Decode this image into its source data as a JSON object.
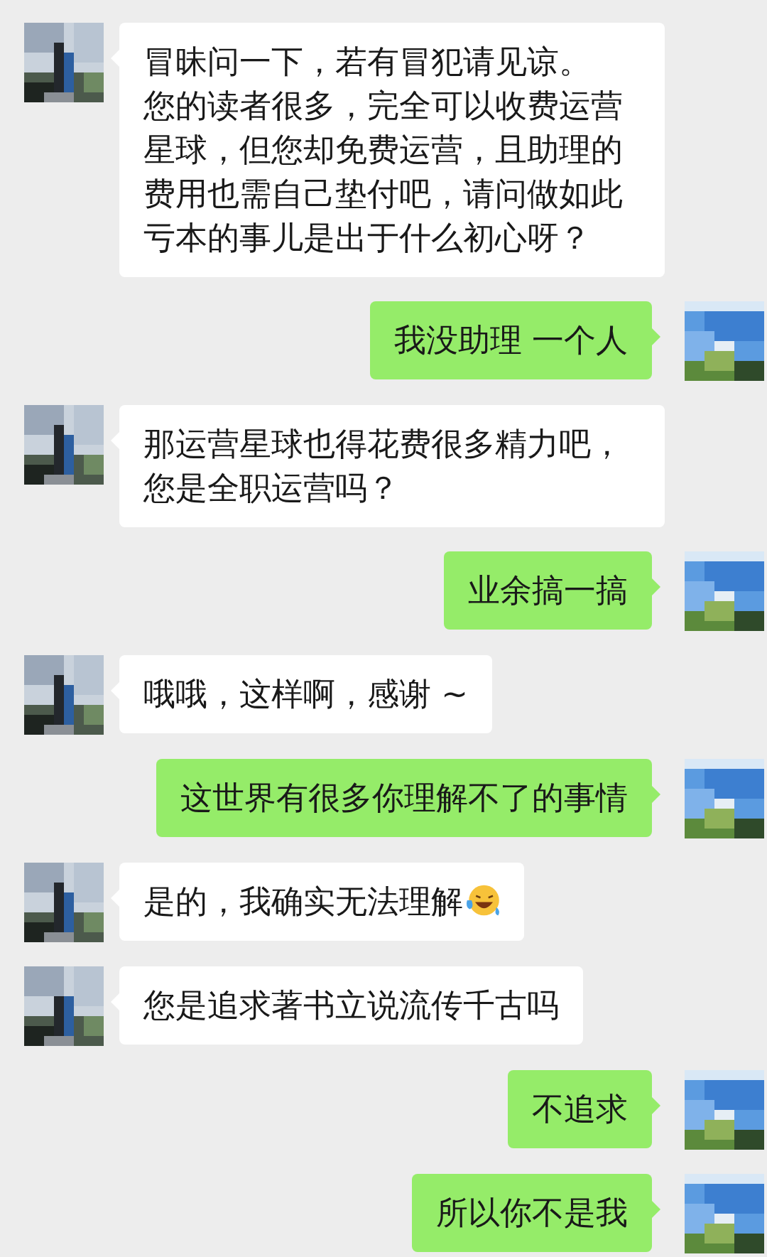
{
  "messages": [
    {
      "kind": "other",
      "paragraphs": [
        "冒昧问一下，若有冒犯请见谅。",
        "您的读者很多，完全可以收费运营星球，但您却免费运营，且助理的费用也需自己垫付吧，请问做如此亏本的事儿是出于什么初心呀？"
      ]
    },
    {
      "kind": "self",
      "paragraphs": [
        "我没助理 一个人"
      ]
    },
    {
      "kind": "other",
      "paragraphs": [
        "那运营星球也得花费很多精力吧，您是全职运营吗？"
      ]
    },
    {
      "kind": "self",
      "paragraphs": [
        "业余搞一搞"
      ]
    },
    {
      "kind": "other",
      "paragraphs": [
        "哦哦，这样啊，感谢 ~"
      ]
    },
    {
      "kind": "self",
      "paragraphs": [
        "这世界有很多你理解不了的事情"
      ]
    },
    {
      "kind": "other",
      "paragraphs": [
        "是的，我确实无法理解"
      ],
      "emoji": true
    },
    {
      "kind": "other",
      "paragraphs": [
        "您是追求著书立说流传千古吗"
      ]
    },
    {
      "kind": "self",
      "paragraphs": [
        "不追求"
      ]
    },
    {
      "kind": "self",
      "paragraphs": [
        "所以你不是我"
      ]
    }
  ]
}
